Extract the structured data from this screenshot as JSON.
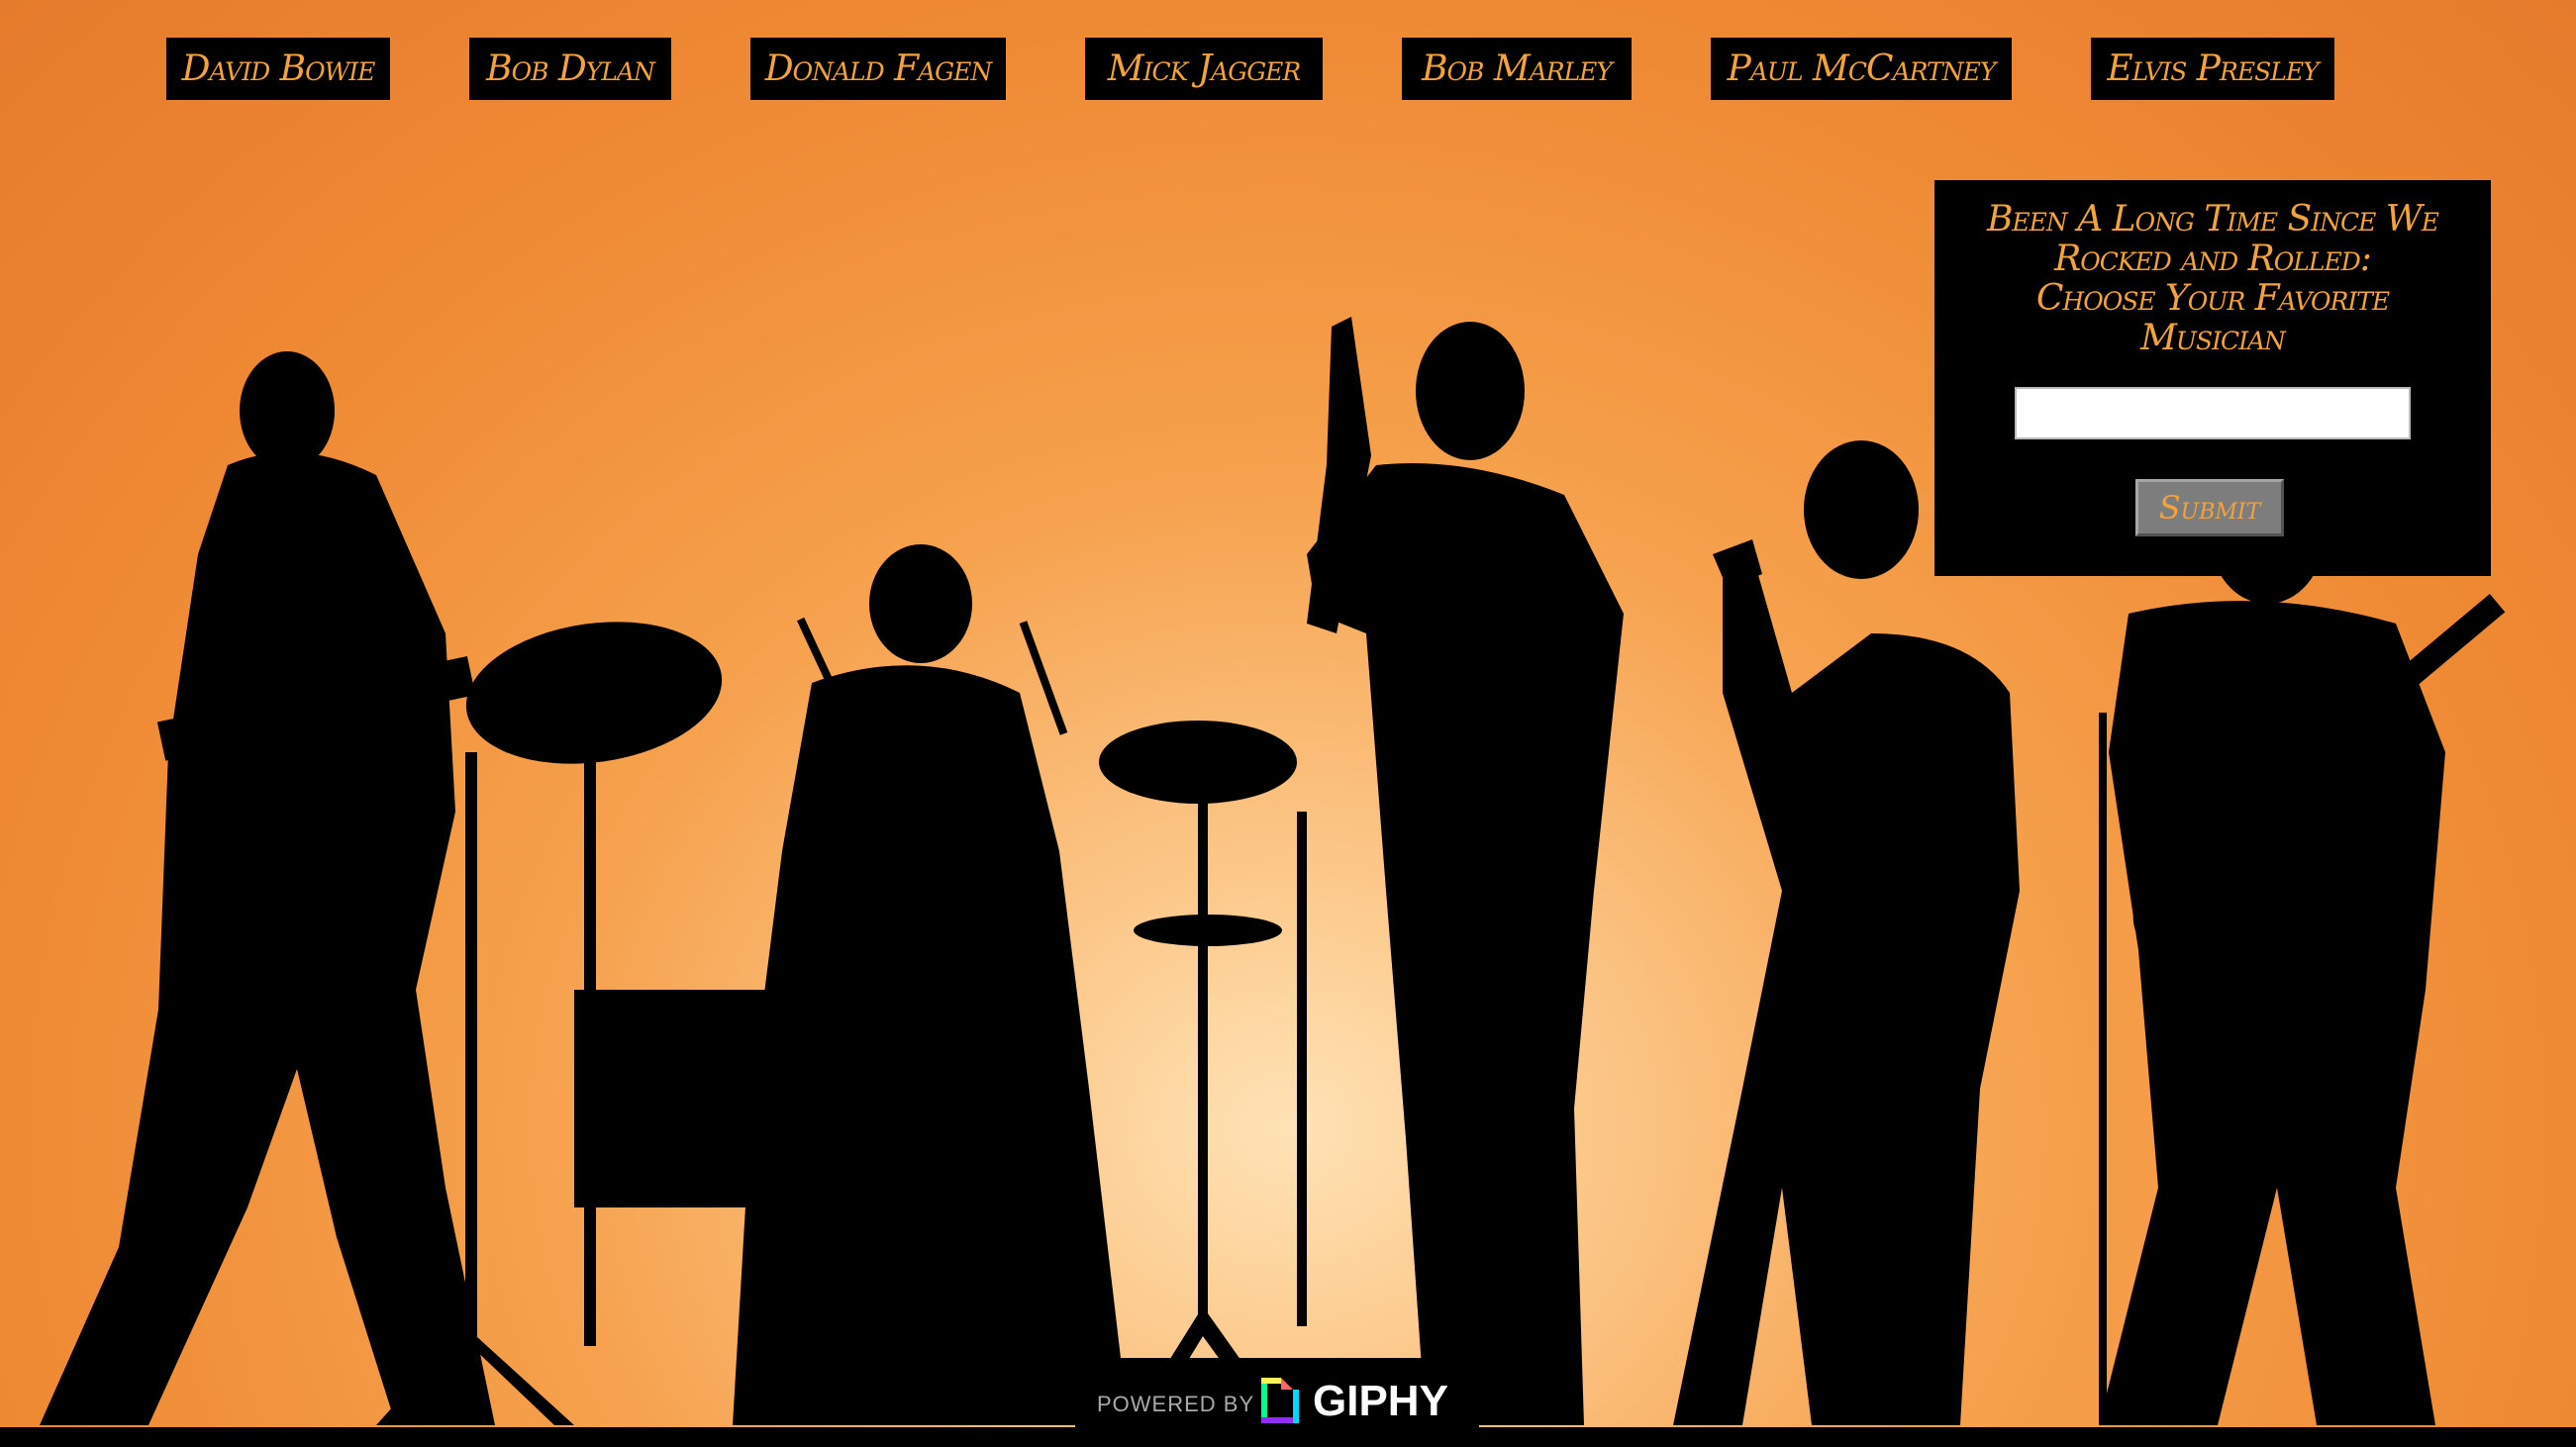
{
  "nav": {
    "buttons": [
      {
        "label": "David Bowie"
      },
      {
        "label": "Bob Dylan"
      },
      {
        "label": "Donald Fagen"
      },
      {
        "label": "Mick Jagger"
      },
      {
        "label": "Bob Marley"
      },
      {
        "label": "Paul McCartney"
      },
      {
        "label": "Elvis Presley"
      }
    ]
  },
  "panel": {
    "title_line1": "Been A Long Time Since We",
    "title_line2": "Rocked and Rolled:",
    "title_line3": "Choose Your Favorite",
    "title_line4": "Musician",
    "input_value": "",
    "submit_label": "Submit"
  },
  "footer": {
    "powered_by": "POWERED BY",
    "brand": "GIPHY"
  },
  "colors": {
    "accent": "#f3a33b",
    "background": "#ef8a34",
    "panel": "#000000"
  },
  "icons": [
    "giphy-logo-icon"
  ]
}
